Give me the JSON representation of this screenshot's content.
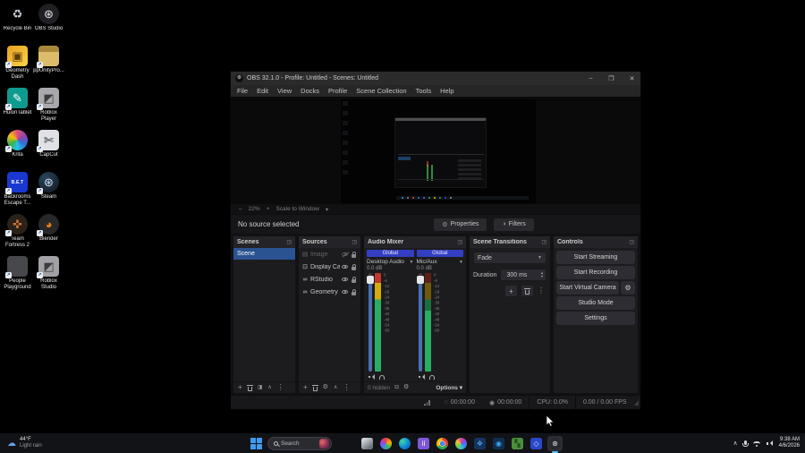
{
  "desktop": {
    "icons": [
      {
        "label": "Recycle Bin",
        "glyph": "♻",
        "fg": "#cdd3da",
        "bg": "transparent",
        "circle": false,
        "shortcut": false,
        "solo": false,
        "small": false
      },
      {
        "label": "OBS Studio",
        "glyph": "⊛",
        "fg": "#e6e6e6",
        "bg": "#202024",
        "circle": true,
        "shortcut": false,
        "solo": false,
        "small": false
      },
      {
        "label": "Geometry Dash",
        "glyph": "▣",
        "fg": "#5a3b07",
        "bg": "linear-gradient(135deg,#e8a020,#f8d448)",
        "circle": false,
        "shortcut": true,
        "solo": false,
        "small": false
      },
      {
        "label": "ppUnityPro...",
        "glyph": "",
        "fg": "#ffffff",
        "bg": "linear-gradient(180deg,#a8893c 0% 30%,#dcbc6a 30% 100%)",
        "circle": false,
        "shortcut": true,
        "solo": false,
        "small": false
      },
      {
        "label": "HuionTablet",
        "glyph": "✎",
        "fg": "#ffffff",
        "bg": "#0e9b8f",
        "circle": false,
        "shortcut": true,
        "solo": false,
        "small": false
      },
      {
        "label": "Roblox Player",
        "glyph": "◩",
        "fg": "#3c3c3c",
        "bg": "#a9a9ad",
        "circle": false,
        "shortcut": true,
        "solo": false,
        "small": false
      },
      {
        "label": "Krita",
        "glyph": "",
        "fg": "#ffffff",
        "bg": "conic-gradient(#e04c7c,#8e44ad,#2e6fd8,#27c4e8,#37b24d,#f4c20d,#e04c7c)",
        "circle": true,
        "shortcut": true,
        "solo": false,
        "small": false
      },
      {
        "label": "CapCut",
        "glyph": "✄",
        "fg": "#222222",
        "bg": "#dfe1e4",
        "circle": false,
        "shortcut": true,
        "solo": false,
        "small": false
      },
      {
        "label": "Backrooms Escape T...",
        "glyph": "B.E.T",
        "fg": "#ffffff",
        "bg": "#1838d0",
        "circle": false,
        "shortcut": true,
        "solo": true,
        "small": true
      },
      {
        "label": "Steam",
        "glyph": "⊛",
        "fg": "#cfe0f2",
        "bg": "radial-gradient(circle at 35% 30%,#2a475e,#10141b)",
        "circle": true,
        "shortcut": true,
        "solo": true,
        "small": false
      },
      {
        "label": "Team Fortress 2",
        "glyph": "✜",
        "fg": "#cf7336",
        "bg": "#2a2119",
        "circle": true,
        "shortcut": true,
        "solo": true,
        "small": false
      },
      {
        "label": "Blender",
        "glyph": "◕",
        "fg": "#ea8116",
        "bg": "#28282b",
        "circle": true,
        "shortcut": true,
        "solo": true,
        "small": false
      },
      {
        "label": "People Playground",
        "glyph": "",
        "fg": "#ffffff",
        "bg": "#46484c",
        "circle": false,
        "shortcut": true,
        "solo": true,
        "small": false
      },
      {
        "label": "Roblox Studio",
        "glyph": "◩",
        "fg": "#3c3c3c",
        "bg": "#a2a2a6",
        "circle": false,
        "shortcut": true,
        "solo": true,
        "small": false
      }
    ]
  },
  "window": {
    "title": "OBS 32.1.0 - Profile: Untitled - Scenes: Untitled",
    "controls": {
      "minimize": "–",
      "maximize": "❒",
      "close": "✕"
    },
    "menu": [
      {
        "label": "File"
      },
      {
        "label": "Edit"
      },
      {
        "label": "View"
      },
      {
        "label": "Docks"
      },
      {
        "label": "Profile"
      },
      {
        "label": "Scene Collection"
      },
      {
        "label": "Tools"
      },
      {
        "label": "Help"
      }
    ],
    "preview_zoom": {
      "zoom_out": "–",
      "level": "22%",
      "zoom_in": "+",
      "mode": "Scale to Window",
      "chevron": "▾"
    },
    "source_row": {
      "status": "No source selected",
      "properties": "Properties",
      "filters": "Filters"
    },
    "scenes": {
      "title": "Scenes",
      "items": [
        {
          "name": "Scene"
        }
      ]
    },
    "sources": {
      "title": "Sources",
      "items": [
        {
          "glyph": "▤",
          "name": "Image",
          "dim": true,
          "hidden": true
        },
        {
          "glyph": "⊡",
          "name": "Display Ca",
          "dim": false,
          "hidden": false
        },
        {
          "glyph": "∞",
          "name": "RStudio",
          "dim": false,
          "hidden": false
        },
        {
          "glyph": "∞",
          "name": "Geometry",
          "dim": false,
          "hidden": false
        }
      ]
    },
    "mixer": {
      "title": "Audio Mixer",
      "channels": [
        {
          "badge": "Global",
          "name": "Desktop Audio",
          "db": "0.0 dB",
          "meter_gradient": "linear-gradient(180deg,#c0392b 0% 10%,#d4ac0d 10% 27%,#27ae60 27% 100%)",
          "scale": "0\n-6\n-12\n-18\n-24\n-30\n-36\n-42\n-48\n-54\n-60"
        },
        {
          "badge": "Global",
          "name": "Mic/Aux",
          "db": "0.0 dB",
          "meter_gradient": "linear-gradient(180deg,#5e1f17 0% 10%,#6e5a0a 10% 27%,#1b6e3f 27% 38%,#27ae60 38% 100%)",
          "scale": "0\n-6\n-12\n-18\n-24\n-30\n-36\n-42\n-48\n-54\n-60"
        }
      ],
      "footer": {
        "hidden_count": "0 hidden",
        "options": "Options",
        "chevron": "▾"
      }
    },
    "transitions": {
      "title": "Scene Transitions",
      "selected": "Fade",
      "duration_label": "Duration",
      "duration_value": "300 ms"
    },
    "controls_panel": {
      "title": "Controls",
      "start_streaming": "Start Streaming",
      "start_recording": "Start Recording",
      "virtual_camera": "Start Virtual Camera",
      "studio_mode": "Studio Mode",
      "settings": "Settings"
    },
    "status": {
      "stream_time": "00:00:00",
      "record_time": "00:00:00",
      "cpu": "CPU: 0.0%",
      "fps": "0.00 / 0.00 FPS"
    }
  },
  "taskbar": {
    "weather": {
      "temp": "44°F",
      "condition": "Light rain"
    },
    "search": {
      "placeholder": "Search"
    },
    "icons": [
      {
        "name": "task-view-icon",
        "bg": "linear-gradient(145deg,#cdd2d8 20%,#6d727a 80%)",
        "glyph": "",
        "fg": "#ffffff",
        "circle": false,
        "active": false
      },
      {
        "name": "photos-icon",
        "bg": "conic-gradient(#e8453c,#f4b400,#3cba54,#4387f4,#a63ce8,#e8453c)",
        "glyph": "",
        "fg": "#ffffff",
        "circle": true,
        "active": false
      },
      {
        "name": "edge-icon",
        "bg": "radial-gradient(circle at 30% 30%,#40d6a8,#0c86d8 55%,#0a4fa8)",
        "glyph": "",
        "fg": "#ffffff",
        "circle": true,
        "active": false
      },
      {
        "name": "people-icon",
        "bg": "#7e57d8",
        "glyph": "ii",
        "fg": "#ffffff",
        "circle": false,
        "active": false
      },
      {
        "name": "chrome-icon",
        "bg": "radial-gradient(circle,#4285f4 0 28%,#ffffff 30% 34%,transparent 35%),conic-gradient(#ea4335 0 33%,#34a853 33% 66%,#fbbc05 66% 100%)",
        "glyph": "",
        "fg": "#ffffff",
        "circle": true,
        "active": false
      },
      {
        "name": "clipchamp-icon",
        "bg": "conic-gradient(#e040a0,#8048e8,#3888f0,#38c8c0,#80d048,#f0c030,#e040a0)",
        "glyph": "",
        "fg": "#ffffff",
        "circle": true,
        "active": false
      },
      {
        "name": "dropbox-icon",
        "bg": "#16335e",
        "glyph": "❖",
        "fg": "#4c9fe8",
        "circle": false,
        "active": false
      },
      {
        "name": "outlook-icon",
        "bg": "#0f2e4e",
        "glyph": "◉",
        "fg": "#38a8f0",
        "circle": false,
        "active": false
      },
      {
        "name": "minecraft-icon",
        "bg": "#4a8f3a",
        "glyph": "▚",
        "fg": "#274e1c",
        "circle": false,
        "active": false
      },
      {
        "name": "visual-studio-icon",
        "bg": "#2848c8",
        "glyph": "◇",
        "fg": "#cfe0ff",
        "circle": false,
        "active": false
      },
      {
        "name": "obs-studio-icon",
        "bg": "#26282e",
        "glyph": "⊛",
        "fg": "#e2e6ea",
        "circle": true,
        "active": true
      }
    ],
    "tray": {
      "time": "9:38 AM",
      "date": "4/6/2026"
    }
  }
}
